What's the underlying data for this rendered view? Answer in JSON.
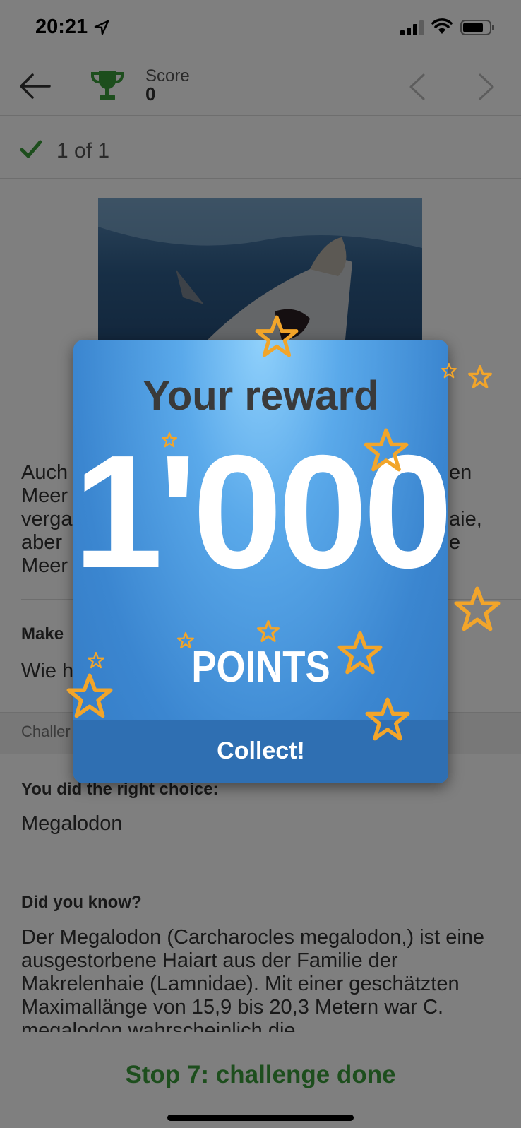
{
  "status_bar": {
    "time": "20:21"
  },
  "nav": {
    "score_label": "Score",
    "score_value": "0"
  },
  "progress": {
    "text": "1 of 1"
  },
  "content": {
    "intro_lines": [
      "Auch",
      "Meer",
      "verga",
      "aber",
      "Meer"
    ],
    "intro_right": [
      "en",
      "aie,",
      "e"
    ],
    "make_title": "Make",
    "make_text": "Wie h",
    "band_text": "Challer",
    "right_choice_title": "You did the right choice:",
    "right_choice_value": "Megalodon",
    "did_you_know_title": "Did you know?",
    "did_you_know_text": "Der Megalodon (Carcharocles megalodon,) ist eine ausgestorbene Haiart aus der Familie der Makrelenhaie (Lamnidae).  Mit einer geschätzten Maximallänge von 15,9 bis 20,3 Metern war C. megalodon wahrscheinlich die"
  },
  "footer": {
    "text": "Stop 7: challenge done"
  },
  "modal": {
    "title": "Your reward",
    "amount": "1'000",
    "unit": "POINTS",
    "button_label": "Collect!"
  },
  "colors": {
    "accent_green": "#3a9c3a",
    "modal_blue": "#3b86d0",
    "star_gold": "#f2a52a"
  }
}
